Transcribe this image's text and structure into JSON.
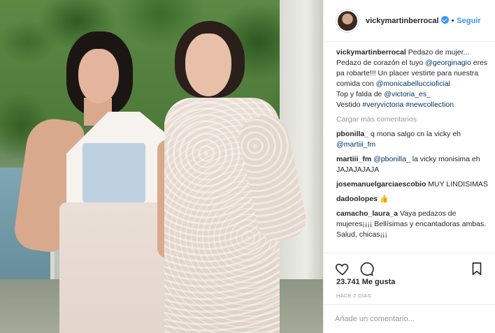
{
  "header": {
    "username": "vickymartinberrocal",
    "separator": "•",
    "follow_label": "Seguir"
  },
  "caption": {
    "username": "vickymartinberrocal",
    "text1": " Pedazo de mujer... Pedazo de corazón el tuyo ",
    "mention1": "@georginagio",
    "text2": " eres pa robarte!!! Un placer vestirte para nuestra comida con ",
    "mention2": "@monicabelluccioficial",
    "text3": " Top y falda de ",
    "mention3": "@victoria_es_",
    "text4": " Vestido ",
    "hashtag1": "#veryvictoria",
    "hashtag2": "#newcollection"
  },
  "load_more_label": "Cargar más comentarios",
  "comments": [
    {
      "username": "pbonilla_",
      "text": " q mona salgo cn la vicky eh ",
      "mention": "@martiii_fm",
      "text_after": ""
    },
    {
      "username": "martiii_fm",
      "text": " ",
      "mention": "@pbonilla_",
      "text_after": " la vicky monisima eh JAJAJAJAJA"
    },
    {
      "username": "josemanuelgarciaescobio",
      "text": " MUY LINDISIMAS",
      "mention": "",
      "text_after": ""
    },
    {
      "username": "dadoolopes",
      "text": " 👍",
      "mention": "",
      "text_after": ""
    },
    {
      "username": "camacho_laura_a",
      "text": " Vaya pedazos de mujeres¡¡¡¡ Bellísimas y encantadoras ambas. Salud, chicas¡¡¡",
      "mention": "",
      "text_after": ""
    }
  ],
  "actions": {
    "like_icon": "heart-icon",
    "comment_icon": "comment-icon",
    "save_icon": "bookmark-icon"
  },
  "likes_label": "23.741 Me gusta",
  "time_label": "HACE 2 DÍAS",
  "comment_input": {
    "placeholder": "Añade un comentario...",
    "value": ""
  },
  "colors": {
    "link": "#003569",
    "accent": "#3897f0",
    "muted": "#999999",
    "text": "#262626"
  }
}
